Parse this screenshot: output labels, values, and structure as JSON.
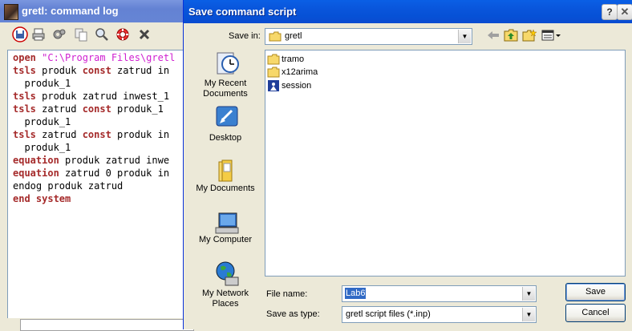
{
  "log_window": {
    "title": "gretl: command log",
    "code_lines": [
      [
        {
          "t": "open",
          "c": "kw"
        },
        {
          "t": " "
        },
        {
          "t": "\"C:\\Program Files\\gretl",
          "c": "str"
        }
      ],
      [
        {
          "t": "tsls",
          "c": "kw"
        },
        {
          "t": " produk "
        },
        {
          "t": "const",
          "c": "kw"
        },
        {
          "t": " zatrud in"
        }
      ],
      [
        {
          "t": "  produk_1"
        }
      ],
      [
        {
          "t": "tsls",
          "c": "kw"
        },
        {
          "t": " produk zatrud inwest_1"
        }
      ],
      [
        {
          "t": "tsls",
          "c": "kw"
        },
        {
          "t": " zatrud "
        },
        {
          "t": "const",
          "c": "kw"
        },
        {
          "t": " produk_1"
        }
      ],
      [
        {
          "t": "  produk_1"
        }
      ],
      [
        {
          "t": "tsls",
          "c": "kw"
        },
        {
          "t": " zatrud "
        },
        {
          "t": "const",
          "c": "kw"
        },
        {
          "t": " produk in"
        }
      ],
      [
        {
          "t": "  produk_1"
        }
      ],
      [
        {
          "t": "equation",
          "c": "kw"
        },
        {
          "t": " produk zatrud inwe"
        }
      ],
      [
        {
          "t": "equation",
          "c": "kw"
        },
        {
          "t": " zatrud 0 produk in"
        }
      ],
      [
        {
          "t": "endog produk zatrud"
        }
      ],
      [
        {
          "t": "end system",
          "c": "kw"
        }
      ]
    ]
  },
  "dialog": {
    "title": "Save command script",
    "help_label": "?",
    "close_label": "✕",
    "save_in_label": "Save in:",
    "save_in_value": "gretl",
    "places": [
      {
        "name": "recent",
        "label": "My Recent\nDocuments"
      },
      {
        "name": "desktop",
        "label": "Desktop"
      },
      {
        "name": "documents",
        "label": "My Documents"
      },
      {
        "name": "computer",
        "label": "My Computer"
      },
      {
        "name": "network",
        "label": "My Network\nPlaces"
      }
    ],
    "files": [
      {
        "name": "tramo",
        "type": "folder"
      },
      {
        "name": "x12arima",
        "type": "folder"
      },
      {
        "name": "session",
        "type": "session"
      }
    ],
    "file_name_label": "File name:",
    "file_name_value": "Lab6",
    "save_as_type_label": "Save as type:",
    "save_as_type_value": "gretl script files (*.inp)",
    "save_button": "Save",
    "cancel_button": "Cancel"
  },
  "colors": {
    "keyword": "#a52a2a",
    "string": "#d020d0",
    "title_bar": "#0a55db",
    "selection": "#316ac5"
  }
}
